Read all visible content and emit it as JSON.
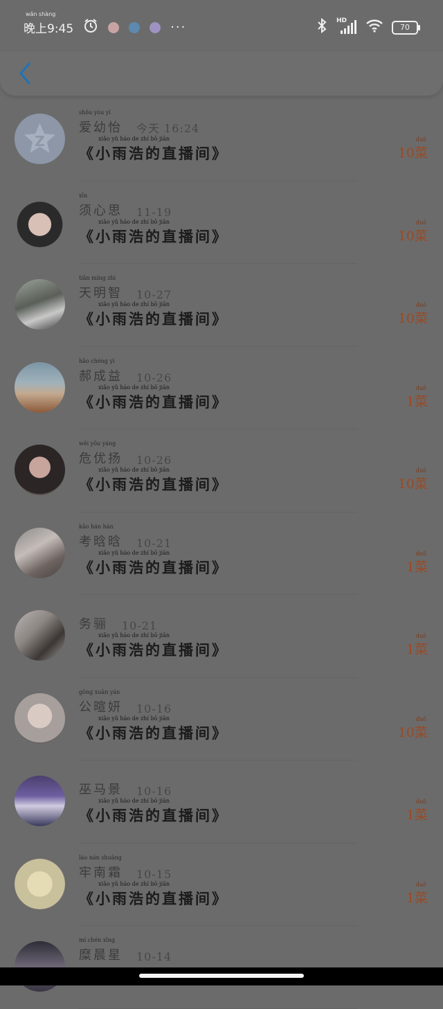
{
  "status": {
    "time": "晚上9:45",
    "time_ruby": "wǎn shàng",
    "more": "···",
    "network": "HD",
    "battery": "70"
  },
  "header": {
    "back_label": ""
  },
  "colors": {
    "count": "#9a4a24",
    "back": "#1f73b7"
  },
  "entries": [
    {
      "name": "爱幼怡",
      "name_ruby": "shǒu yòu yí",
      "date": "今天 16:24",
      "title": "《小雨浩的直播间》",
      "title_ruby": "xiǎo yǔ hào de zhí bō jiān",
      "count": "10菜",
      "count_ruby": "duǒ",
      "avatar_icon": "qq-star-icon"
    },
    {
      "name": "须心思",
      "name_ruby": "xīn",
      "date": "11-19",
      "title": "《小雨浩的直播间》",
      "title_ruby": "xiǎo yǔ hào de zhí bō jiān",
      "count": "10菜",
      "count_ruby": "duǒ",
      "avatar_icon": "cartoon-avatar"
    },
    {
      "name": "天明智",
      "name_ruby": "tiān míng zhì",
      "date": "10-27",
      "title": "《小雨浩的直播间》",
      "title_ruby": "xiǎo yǔ hào de zhí bō jiān",
      "count": "10菜",
      "count_ruby": "duǒ",
      "avatar_icon": "photo-avatar"
    },
    {
      "name": "郝成益",
      "name_ruby": "hǎo chéng yì",
      "date": "10-26",
      "title": "《小雨浩的直播间》",
      "title_ruby": "xiǎo yǔ hào de zhí bō jiān",
      "count": "1菜",
      "count_ruby": "duǒ",
      "avatar_icon": "photo-avatar"
    },
    {
      "name": "危优扬",
      "name_ruby": "wēi yōu yáng",
      "date": "10-26",
      "title": "《小雨浩的直播间》",
      "title_ruby": "xiǎo yǔ hào de zhí bō jiān",
      "count": "10菜",
      "count_ruby": "duǒ",
      "avatar_icon": "photo-avatar"
    },
    {
      "name": "考晗晗",
      "name_ruby": "kǎo hán hán",
      "date": "10-21",
      "title": "《小雨浩的直播间》",
      "title_ruby": "xiǎo yǔ hào de zhí bō jiān",
      "count": "1菜",
      "count_ruby": "duǒ",
      "avatar_icon": "photo-avatar"
    },
    {
      "name": "务骊",
      "name_ruby": "",
      "date": "10-21",
      "title": "《小雨浩的直播间》",
      "title_ruby": "xiǎo yǔ hào de zhí bō jiān",
      "count": "1菜",
      "count_ruby": "duǒ",
      "avatar_icon": "photo-avatar"
    },
    {
      "name": "公暄妍",
      "name_ruby": "gōng xuān yán",
      "date": "10-16",
      "title": "《小雨浩的直播间》",
      "title_ruby": "xiǎo yǔ hào de zhí bō jiān",
      "count": "10菜",
      "count_ruby": "duǒ",
      "avatar_icon": "photo-avatar"
    },
    {
      "name": "巫马景",
      "name_ruby": "",
      "date": "10-16",
      "title": "《小雨浩的直播间》",
      "title_ruby": "xiǎo yǔ hào de zhí bō jiān",
      "count": "1菜",
      "count_ruby": "duǒ",
      "avatar_icon": "cartoon-avatar"
    },
    {
      "name": "牢南霜",
      "name_ruby": "láo nán shuāng",
      "date": "10-15",
      "title": "《小雨浩的直播间》",
      "title_ruby": "xiǎo yǔ hào de zhí bō jiān",
      "count": "1菜",
      "count_ruby": "duǒ",
      "avatar_icon": "cartoon-avatar"
    },
    {
      "name": "糜晨星",
      "name_ruby": "mí chén xīng",
      "date": "10-14",
      "title": "",
      "title_ruby": "",
      "count": "",
      "count_ruby": "",
      "avatar_icon": "photo-avatar"
    }
  ]
}
